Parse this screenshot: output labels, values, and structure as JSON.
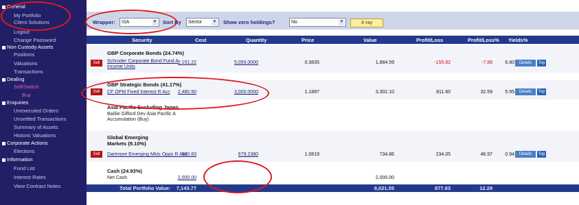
{
  "sidebar": {
    "items": [
      {
        "label": "General",
        "section": true
      },
      {
        "label": "My Portfolio"
      },
      {
        "label": "Client Solutions"
      },
      {
        "label": "Logout"
      },
      {
        "label": "Change Password"
      },
      {
        "label": "Non Custody Assets",
        "section": true
      },
      {
        "label": "Positions"
      },
      {
        "label": "Valuations"
      },
      {
        "label": "Transactions"
      },
      {
        "label": "Dealing",
        "section": true
      },
      {
        "label": "Sell/Switch",
        "active": true
      },
      {
        "label": "Buy"
      },
      {
        "label": "Enquiries",
        "section": true
      },
      {
        "label": "Unexecuted Orders"
      },
      {
        "label": "Unsettled Transactions"
      },
      {
        "label": "Summary of Assets"
      },
      {
        "label": "Historic Valuations"
      },
      {
        "label": "Corporate Actions",
        "section": true
      },
      {
        "label": "Elections"
      },
      {
        "label": "Information",
        "section": true
      },
      {
        "label": "Fund List"
      },
      {
        "label": "Interest Rates"
      },
      {
        "label": "View Contract Notes"
      }
    ]
  },
  "toolbar": {
    "wrapper_label": "Wrapper:",
    "wrapper_value": "ISA",
    "sortby_label": "Sort By",
    "sortby_value": "Sector",
    "zero_label": "Show zero holdings?",
    "zero_value": "No",
    "xray_label": "X-ray"
  },
  "table": {
    "headers": [
      "Security",
      "Cost",
      "Quantity",
      "Price",
      "Value",
      "Profit/Loss",
      "Profit/Loss%",
      "Yields%"
    ],
    "sell_label": "Sell",
    "details_label": "Details",
    "top_label": "Top",
    "groups": [
      {
        "title": "GBP Corporate Bonds (24.74%)",
        "rows": [
          {
            "security": "Schroder Corporate Bond Fund A Income Units",
            "cost": "2,151.22",
            "quantity": "5,055.0000",
            "price": "0.3835",
            "value": "1,884.59",
            "pl": "-155.82",
            "plpct": "-7.88",
            "yield": "6.80"
          }
        ]
      },
      {
        "title": "GBP Strategic Bonds (41.17%)",
        "rows": [
          {
            "security": "CF OPM Fixed Interest R Acc",
            "cost": "2,480.50",
            "quantity": "3,000.0000",
            "price": "1.1887",
            "value": "3,302.10",
            "pl": "811.60",
            "plpct": "32.59",
            "yield": "5.95"
          }
        ]
      },
      {
        "title": "Asia Pacific Excluding Japan",
        "note": "Baillie Gifford Dev Asia Pacific A Accumulation (Buy)",
        "rows": []
      },
      {
        "title": "Global Emerging Markets (9.10%)",
        "rows": [
          {
            "security": "Dartmore Emerging Mkts Opps R Acc",
            "cost": "500.83",
            "quantity": "679.2380",
            "price": "1.0819",
            "value": "734.86",
            "pl": "234.05",
            "plpct": "46.97",
            "yield": "0.94"
          }
        ]
      },
      {
        "title": "Cash (24.93%)",
        "cash": {
          "label": "Net Cash",
          "cost": "2,000.00",
          "value": "2,000.00"
        }
      }
    ],
    "total": {
      "label": "Total Portfolio Value:",
      "cost": "7,143.77",
      "value": "8,021.55",
      "pl": "877.83",
      "plpct": "12.29"
    }
  },
  "colors": {
    "sidebar_bg": "#231f66",
    "header_bg": "#233a8c",
    "accent_red": "#d01010",
    "annotation_red": "#e0181e"
  }
}
